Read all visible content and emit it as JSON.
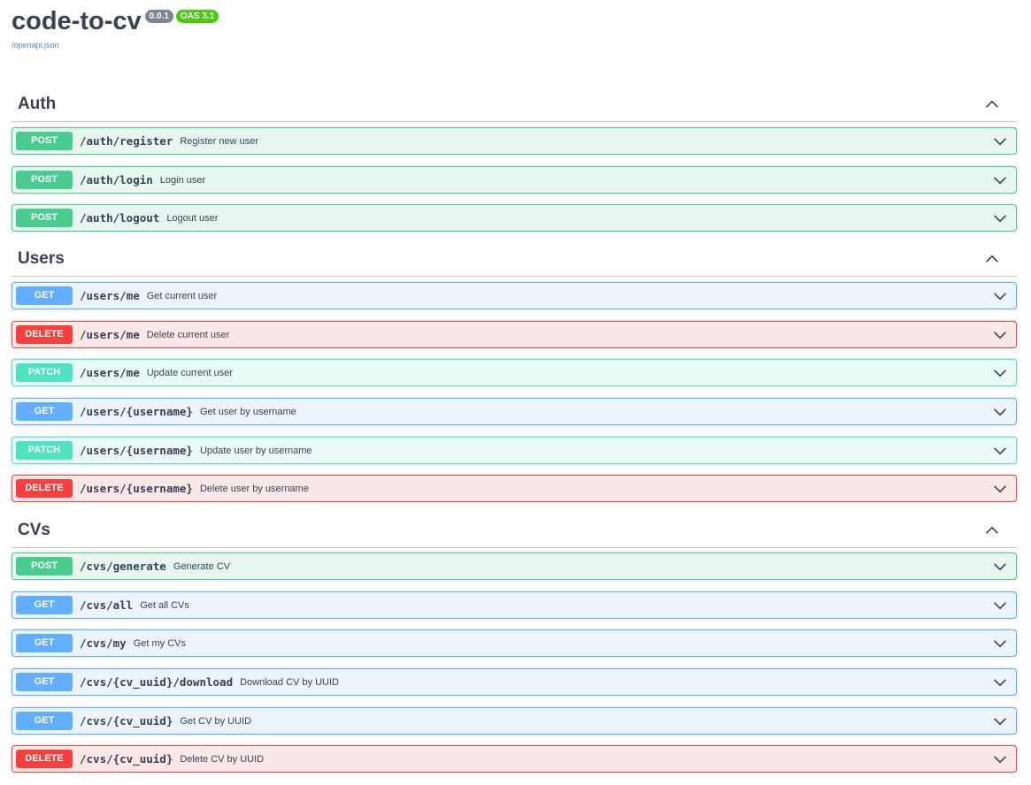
{
  "info": {
    "title": "code-to-cv",
    "version": "0.0.1",
    "oas": "OAS 3.1",
    "spec_link": "/openapi.json"
  },
  "sections": [
    {
      "name": "Auth",
      "operations": [
        {
          "method": "POST",
          "path": "/auth/register",
          "summary": "Register new user"
        },
        {
          "method": "POST",
          "path": "/auth/login",
          "summary": "Login user"
        },
        {
          "method": "POST",
          "path": "/auth/logout",
          "summary": "Logout user"
        }
      ]
    },
    {
      "name": "Users",
      "operations": [
        {
          "method": "GET",
          "path": "/users/me",
          "summary": "Get current user"
        },
        {
          "method": "DELETE",
          "path": "/users/me",
          "summary": "Delete current user"
        },
        {
          "method": "PATCH",
          "path": "/users/me",
          "summary": "Update current user"
        },
        {
          "method": "GET",
          "path": "/users/{username}",
          "summary": "Get user by username"
        },
        {
          "method": "PATCH",
          "path": "/users/{username}",
          "summary": "Update user by username"
        },
        {
          "method": "DELETE",
          "path": "/users/{username}",
          "summary": "Delete user by username"
        }
      ]
    },
    {
      "name": "CVs",
      "operations": [
        {
          "method": "POST",
          "path": "/cvs/generate",
          "summary": "Generate CV"
        },
        {
          "method": "GET",
          "path": "/cvs/all",
          "summary": "Get all CVs"
        },
        {
          "method": "GET",
          "path": "/cvs/my",
          "summary": "Get my CVs"
        },
        {
          "method": "GET",
          "path": "/cvs/{cv_uuid}/download",
          "summary": "Download CV by UUID"
        },
        {
          "method": "GET",
          "path": "/cvs/{cv_uuid}",
          "summary": "Get CV by UUID"
        },
        {
          "method": "DELETE",
          "path": "/cvs/{cv_uuid}",
          "summary": "Delete CV by UUID"
        }
      ]
    }
  ],
  "colors": {
    "post": "#49cc90",
    "get": "#61affe",
    "delete": "#f93e3e",
    "patch": "#50e3c2",
    "text": "#3b4151",
    "link": "#4990e2",
    "version_badge": "#7d8492",
    "oas_badge": "#49cc0f"
  },
  "icons": {
    "section_toggle": "chevron-up-icon",
    "operation_toggle": "chevron-down-icon"
  }
}
